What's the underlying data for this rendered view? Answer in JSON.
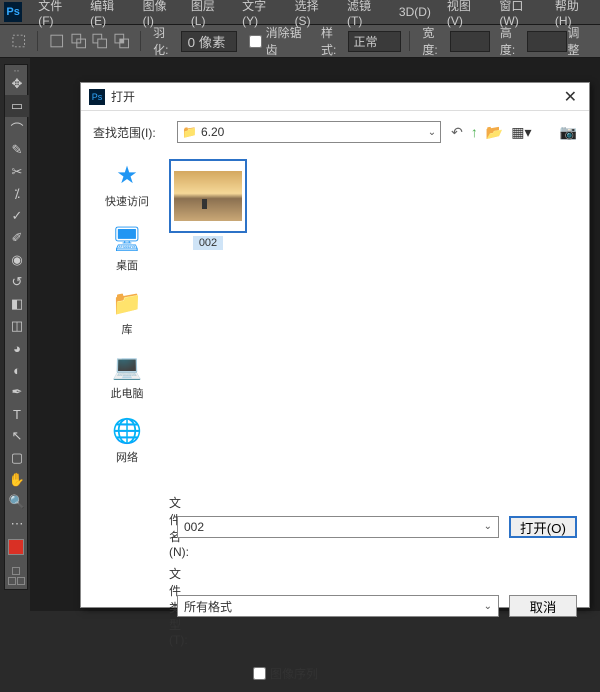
{
  "menu": {
    "items": [
      "文件(F)",
      "编辑(E)",
      "图像(I)",
      "图层(L)",
      "文字(Y)",
      "选择(S)",
      "滤镜(T)",
      "3D(D)",
      "视图(V)",
      "窗口(W)",
      "帮助(H)"
    ]
  },
  "options": {
    "feather_label": "羽化:",
    "feather_value": "0 像素",
    "antialias": "消除锯齿",
    "style_label": "样式:",
    "style_value": "正常",
    "width_label": "宽度:",
    "height_label": "高度:",
    "adjust": "调整"
  },
  "dialog": {
    "title": "打开",
    "lookin_label": "查找范围(I):",
    "lookin_value": "6.20",
    "places": {
      "quick": "快速访问",
      "desktop": "桌面",
      "library": "库",
      "thispc": "此电脑",
      "network": "网络"
    },
    "file_name": "002",
    "filename_label": "文件名(N):",
    "filename_value": "002",
    "filetype_label": "文件类型(T):",
    "filetype_value": "所有格式",
    "open": "打开(O)",
    "cancel": "取消",
    "sequence": "图像序列"
  }
}
